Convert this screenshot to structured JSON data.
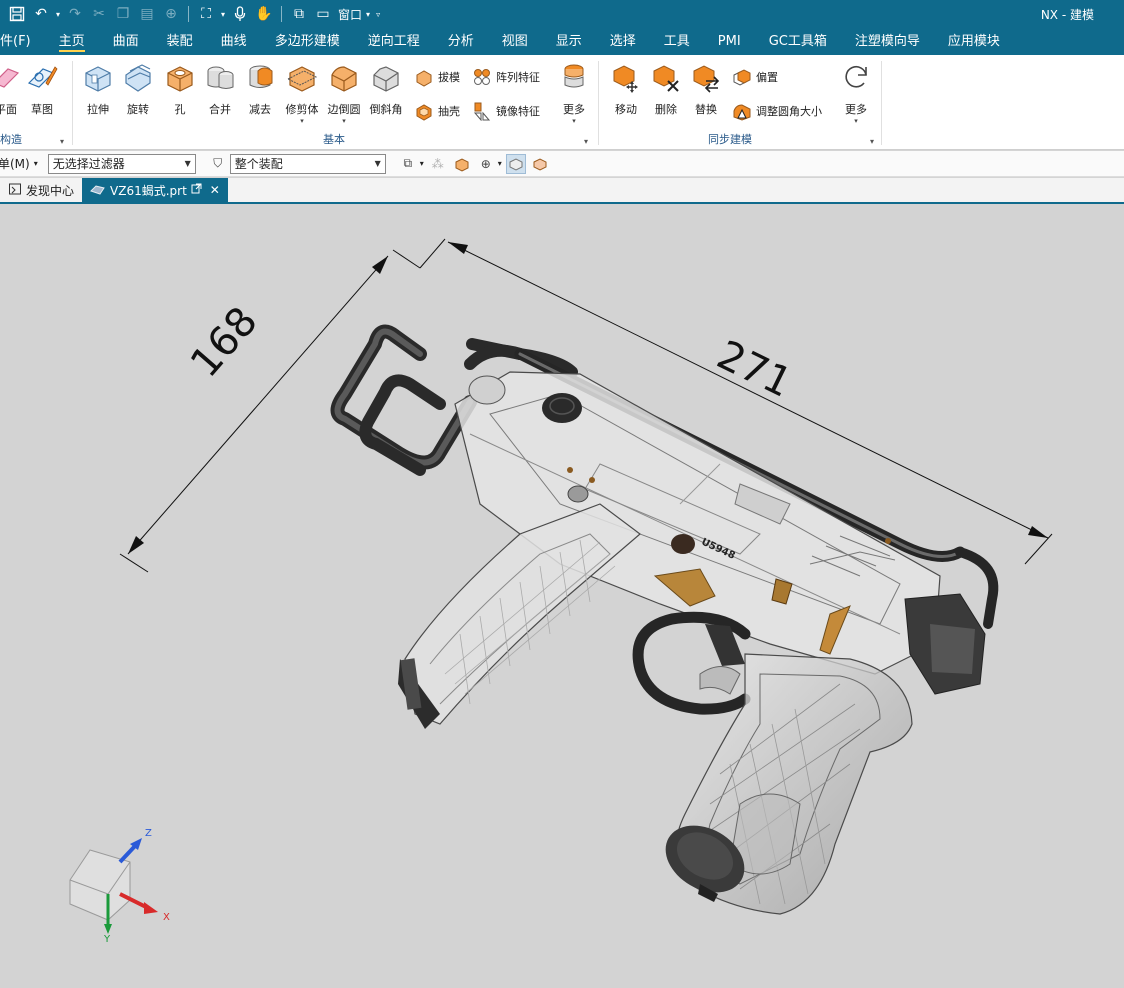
{
  "titlebar": {
    "app_title": "NX - 建模",
    "window_menu_label": "窗口"
  },
  "menubar": {
    "tabs": [
      {
        "label": "件(F)"
      },
      {
        "label": "主页",
        "active": true
      },
      {
        "label": "曲面"
      },
      {
        "label": "装配"
      },
      {
        "label": "曲线"
      },
      {
        "label": "多边形建模"
      },
      {
        "label": "逆向工程"
      },
      {
        "label": "分析"
      },
      {
        "label": "视图"
      },
      {
        "label": "显示"
      },
      {
        "label": "选择"
      },
      {
        "label": "工具"
      },
      {
        "label": "PMI"
      },
      {
        "label": "GC工具箱"
      },
      {
        "label": "注塑模向导"
      },
      {
        "label": "应用模块"
      }
    ]
  },
  "ribbon": {
    "construct_group": {
      "label": "构造",
      "buttons": [
        {
          "label": "平面"
        },
        {
          "label": "草图"
        }
      ]
    },
    "basic_group": {
      "label": "基本",
      "buttons": [
        {
          "label": "拉伸"
        },
        {
          "label": "旋转"
        },
        {
          "label": "孔"
        },
        {
          "label": "合并"
        },
        {
          "label": "减去"
        },
        {
          "label": "修剪体"
        },
        {
          "label": "边倒圆"
        },
        {
          "label": "倒斜角"
        }
      ],
      "small_buttons": [
        {
          "label": "拔模"
        },
        {
          "label": "阵列特征"
        },
        {
          "label": "抽壳"
        },
        {
          "label": "镜像特征"
        }
      ],
      "more_label": "更多"
    },
    "sync_group": {
      "label": "同步建模",
      "buttons": [
        {
          "label": "移动"
        },
        {
          "label": "删除"
        },
        {
          "label": "替换"
        }
      ],
      "small_buttons": [
        {
          "label": "偏置"
        },
        {
          "label": "调整圆角大小"
        }
      ],
      "more_label": "更多"
    }
  },
  "selection_bar": {
    "menu_label": "菜单(M)",
    "filter_value": "无选择过滤器",
    "scope_value": "整个装配"
  },
  "doc_tabs": [
    {
      "label": "发现中心"
    },
    {
      "label": "VZ61蝎式.prt",
      "active": true
    }
  ],
  "viewport": {
    "dimension_vertical": "168",
    "dimension_horizontal": "271",
    "serial_marking": "U5948",
    "triad": {
      "x_label": "X",
      "y_label": "Y",
      "z_label": "Z"
    }
  },
  "colors": {
    "brand": "#0f6a8c",
    "active_tab_underline": "#ffd24d",
    "viewport_bg": "#d3d3d3",
    "icon_orange": "#f08a24"
  }
}
